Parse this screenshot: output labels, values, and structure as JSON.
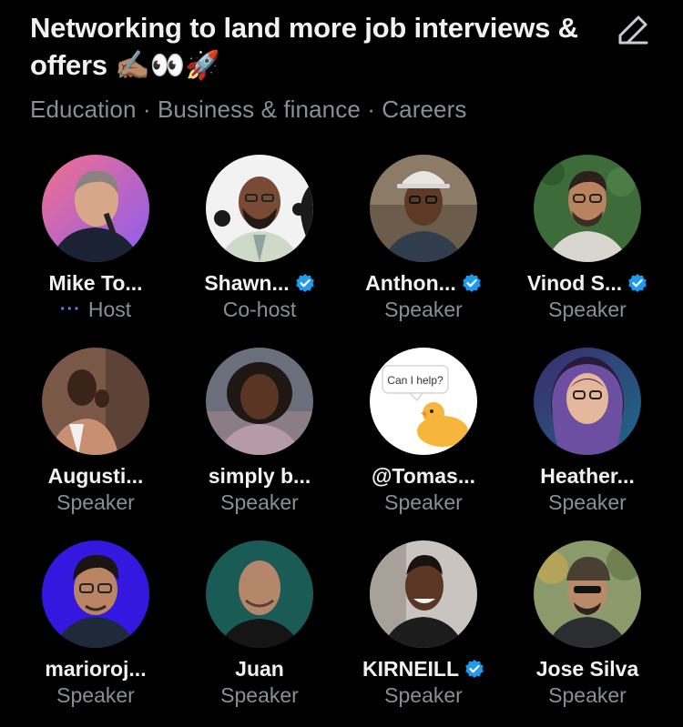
{
  "space": {
    "title": "Networking to land more job interviews & offers ✍🏽👀🚀",
    "topics": "Education · Business & finance · Careers",
    "edit_icon": "pencil-icon"
  },
  "participants": [
    {
      "name": "Mike To...",
      "role": "Host",
      "verified": false
    },
    {
      "name": "Shawn...",
      "role": "Co-host",
      "verified": true
    },
    {
      "name": "Anthon...",
      "role": "Speaker",
      "verified": true
    },
    {
      "name": "Vinod S...",
      "role": "Speaker",
      "verified": true
    },
    {
      "name": "Augusti...",
      "role": "Speaker",
      "verified": false
    },
    {
      "name": "simply b...",
      "role": "Speaker",
      "verified": false
    },
    {
      "name": "@Tomas...",
      "role": "Speaker",
      "verified": false,
      "avatar_text": "Can I help?"
    },
    {
      "name": "Heather...",
      "role": "Speaker",
      "verified": false
    },
    {
      "name": "marioroj...",
      "role": "Speaker",
      "verified": false
    },
    {
      "name": "Juan",
      "role": "Speaker",
      "verified": false
    },
    {
      "name": "KIRNEILL",
      "role": "Speaker",
      "verified": true
    },
    {
      "name": "Jose Silva",
      "role": "Speaker",
      "verified": false
    }
  ],
  "colors": {
    "background": "#000000",
    "muted": "#8b8f94",
    "verified": "#1d9bf0",
    "host_accent": "#8b6cf0"
  }
}
